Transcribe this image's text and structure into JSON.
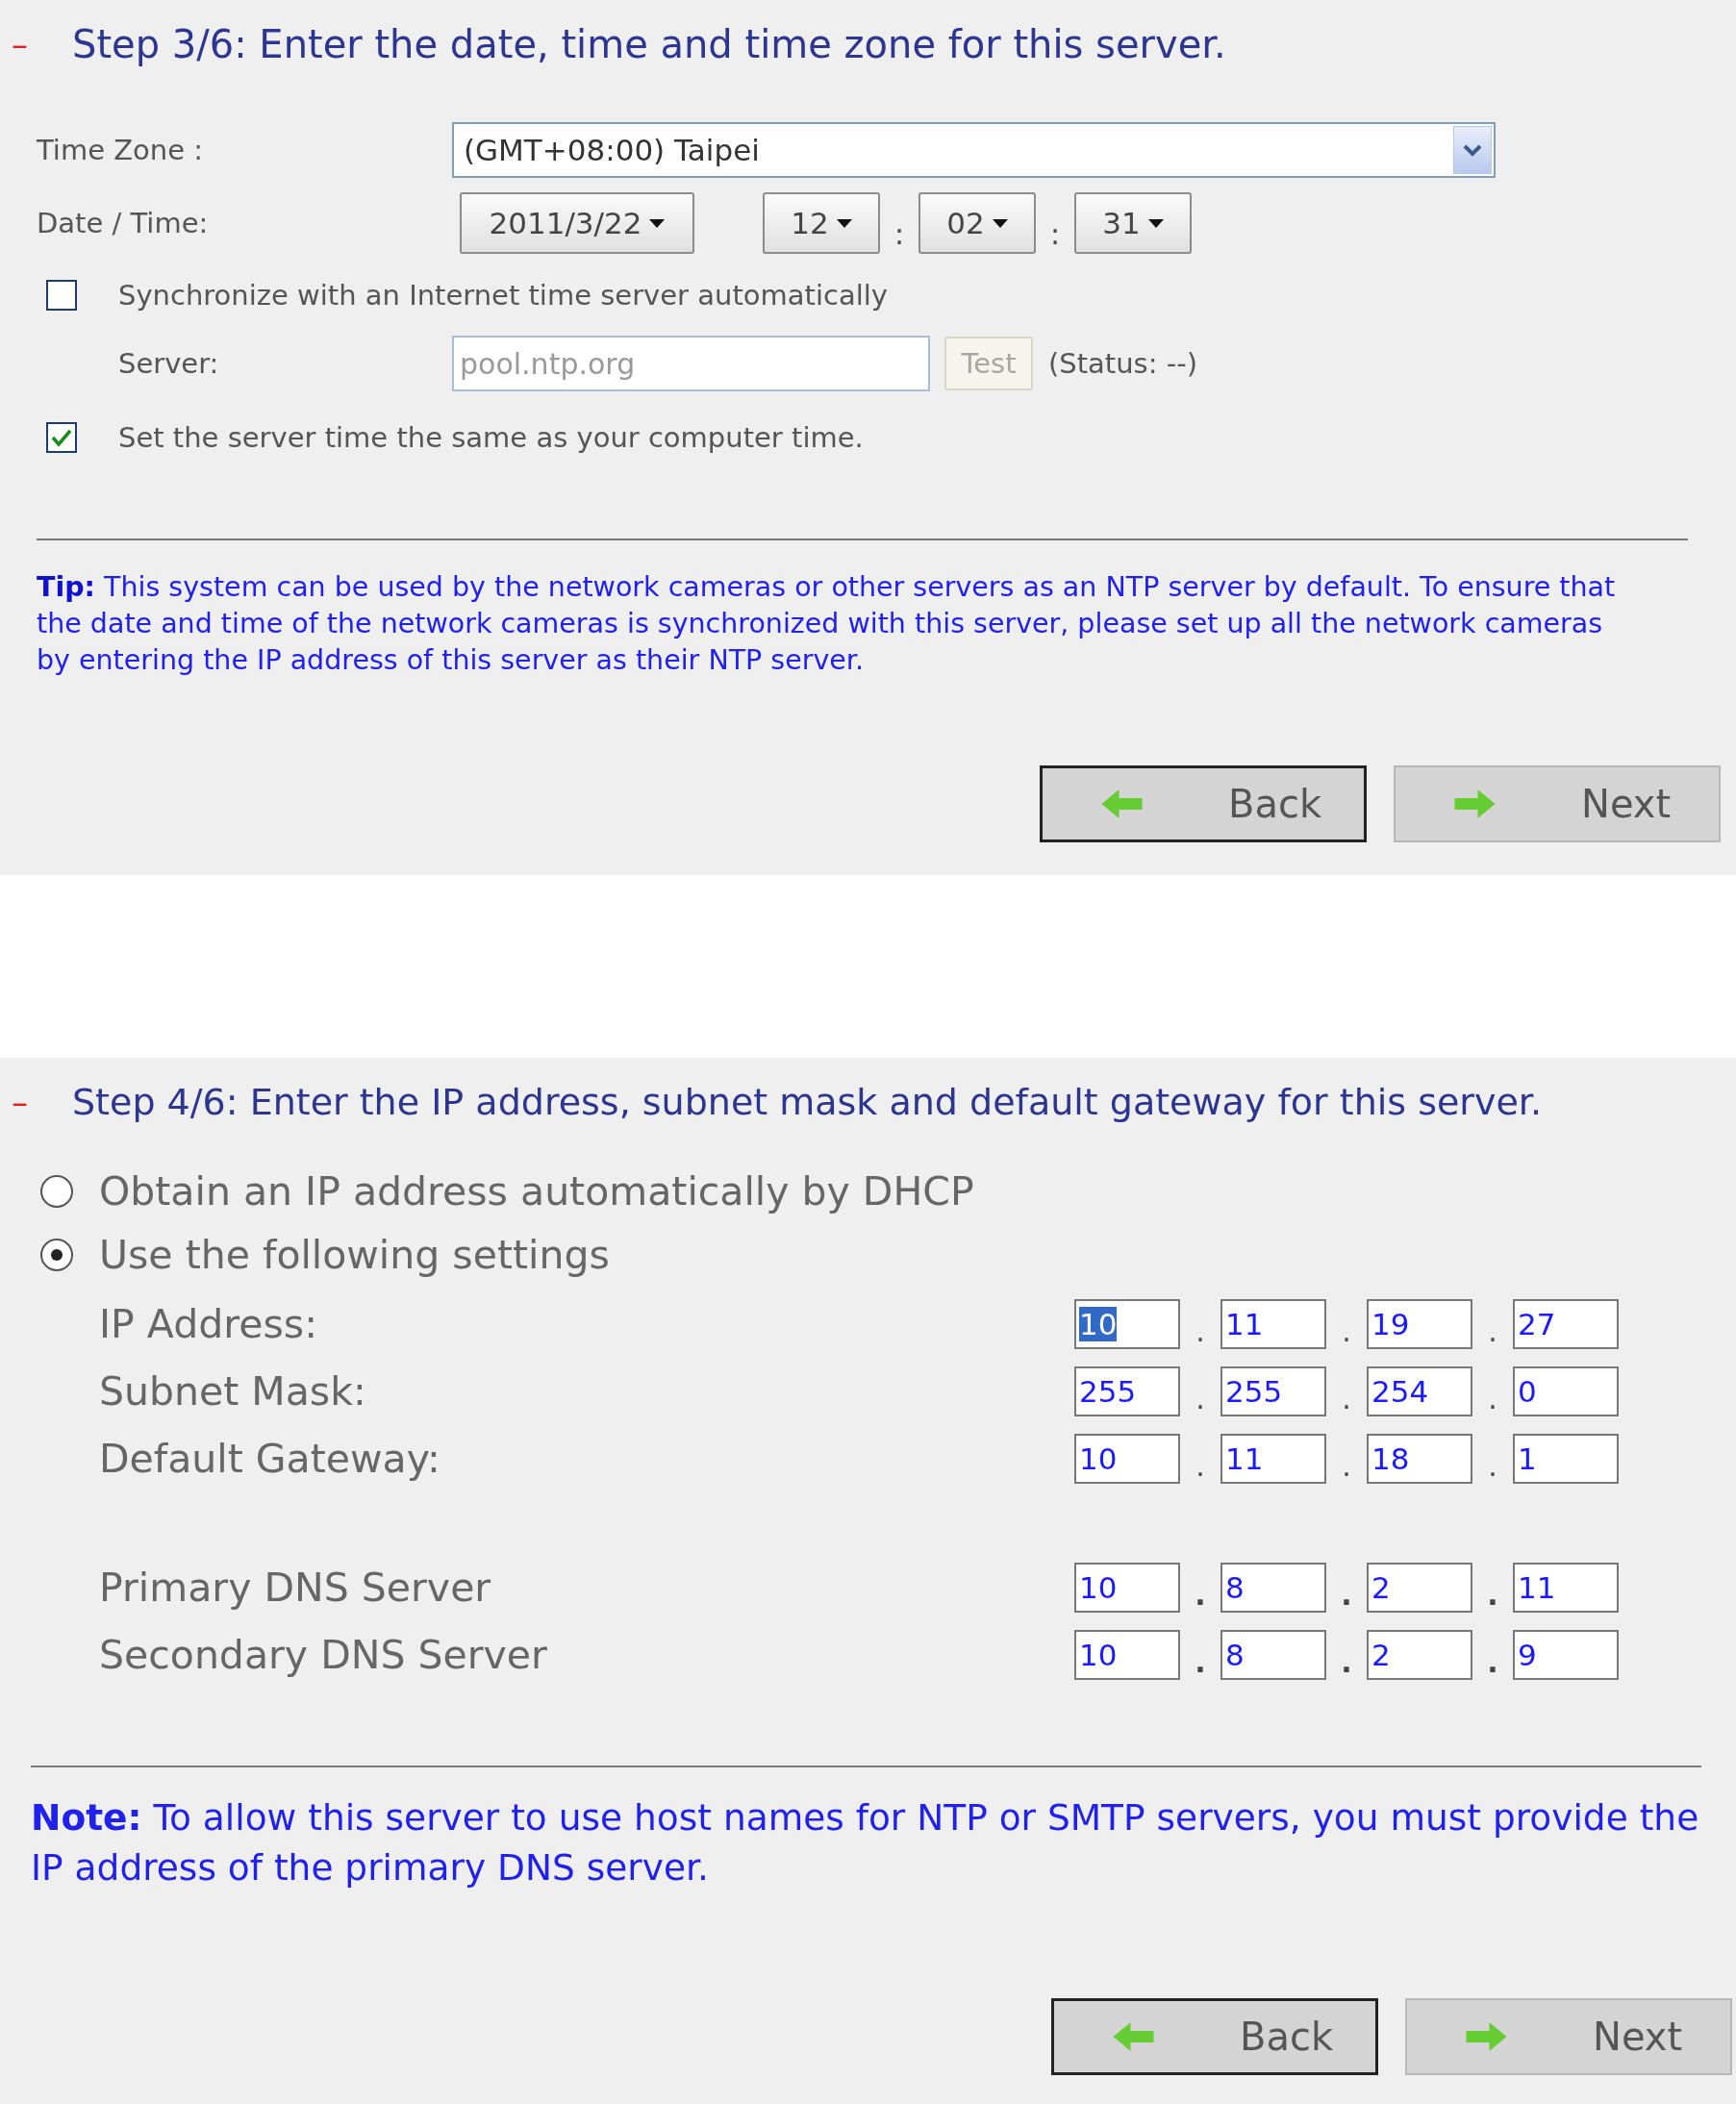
{
  "step3": {
    "dash": "–",
    "title": "Step 3/6: Enter the date, time and time zone for this server.",
    "time_zone": {
      "label": "Time Zone :",
      "value": "(GMT+08:00) Taipei"
    },
    "date_time": {
      "label": "Date / Time:",
      "date": "2011/3/22",
      "hour": "12",
      "minute": "02",
      "second": "31",
      "separator": ":"
    },
    "sync": {
      "label": "Synchronize with an Internet time server automatically",
      "checked": false
    },
    "server": {
      "label": "Server:",
      "placeholder": "pool.ntp.org",
      "test_button": "Test",
      "disabled": true,
      "status": "(Status: --)"
    },
    "same_as_computer": {
      "label": "Set the server time the same as your computer time.",
      "checked": true
    },
    "tip": "**Tip:** This system can be used by the network cameras or other servers as an NTP server by default. To ensure that the date and time of the network cameras is synchronized with this server, please set up all the network cameras by entering the IP address of this server as their NTP server.",
    "buttons": [
      {
        "kind": "back",
        "label": "Back",
        "focused": true
      },
      {
        "kind": "next",
        "label": "Next",
        "focused": false
      }
    ]
  },
  "step4": {
    "dash": "–",
    "title": "Step 4/6: Enter the IP address, subnet mask and default gateway for this server.",
    "options": [
      {
        "label": "Obtain an IP address automatically by DHCP",
        "selected": false
      },
      {
        "label": "Use the following settings",
        "selected": true
      }
    ],
    "groups": [
      [
        {
          "label": "IP Address:",
          "octets": [
            {
              "value": "10",
              "selected": true
            },
            {
              "value": "11",
              "selected": false
            },
            {
              "value": "19",
              "selected": false
            },
            {
              "value": "27",
              "selected": false
            }
          ]
        },
        {
          "label": "Subnet Mask:",
          "octets": [
            {
              "value": "255",
              "selected": false
            },
            {
              "value": "255",
              "selected": false
            },
            {
              "value": "254",
              "selected": false
            },
            {
              "value": "0",
              "selected": false
            }
          ]
        },
        {
          "label": "Default Gateway:",
          "octets": [
            {
              "value": "10",
              "selected": false
            },
            {
              "value": "11",
              "selected": false
            },
            {
              "value": "18",
              "selected": false
            },
            {
              "value": "1",
              "selected": false
            }
          ]
        }
      ],
      [
        {
          "label": "Primary DNS Server",
          "octets": [
            {
              "value": "10",
              "selected": false
            },
            {
              "value": "8",
              "selected": false
            },
            {
              "value": "2",
              "selected": false
            },
            {
              "value": "11",
              "selected": false
            }
          ]
        },
        {
          "label": "Secondary DNS Server",
          "octets": [
            {
              "value": "10",
              "selected": false
            },
            {
              "value": "8",
              "selected": false
            },
            {
              "value": "2",
              "selected": false
            },
            {
              "value": "9",
              "selected": false
            }
          ]
        }
      ]
    ],
    "dot": ".",
    "note": "**Note:** To allow this server to use host names for NTP or SMTP servers, you must provide the IP address of the primary DNS server.",
    "buttons": [
      {
        "kind": "back",
        "label": "Back",
        "focused": true
      },
      {
        "kind": "next",
        "label": "Next",
        "focused": false
      }
    ]
  }
}
